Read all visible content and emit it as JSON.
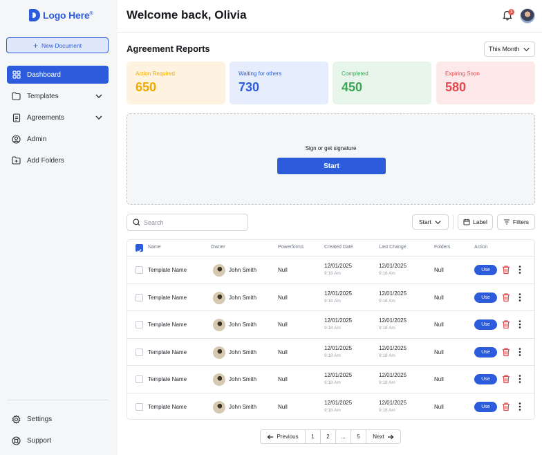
{
  "brand": {
    "logo_text": "Logo Here",
    "logo_mark": "®",
    "accent": "#2c5cdb"
  },
  "sidebar": {
    "new_document": "New Document",
    "items": [
      {
        "label": "Dashboard",
        "icon": "grid-icon",
        "active": true
      },
      {
        "label": "Templates",
        "icon": "folder-icon",
        "expandable": true
      },
      {
        "label": "Agreements",
        "icon": "document-icon",
        "expandable": true
      },
      {
        "label": "Admin",
        "icon": "user-icon"
      },
      {
        "label": "Add Folders",
        "icon": "folder-plus-icon"
      }
    ],
    "bottom_items": [
      {
        "label": "Settings",
        "icon": "gear-icon"
      },
      {
        "label": "Support",
        "icon": "lifebuoy-icon"
      }
    ]
  },
  "header": {
    "title": "Welcome back, Olivia",
    "notification_count": "3"
  },
  "reports": {
    "title": "Agreement Reports",
    "period": "This Month",
    "stats": [
      {
        "label": "Action Required",
        "value": "650",
        "color": "#f2a900",
        "bg": "#fdf3e0"
      },
      {
        "label": "Waiting for others",
        "value": "730",
        "color": "#2c5cdb",
        "bg": "#e6edfc"
      },
      {
        "label": "Completed",
        "value": "450",
        "color": "#3aa654",
        "bg": "#e8f5eb"
      },
      {
        "label": "Expiring Soon",
        "value": "580",
        "color": "#e5484d",
        "bg": "#fde9ea"
      }
    ]
  },
  "signature": {
    "prompt": "Sign or get signature",
    "button": "Start"
  },
  "toolbar": {
    "search_placeholder": "Search",
    "start_filter": "Start",
    "label_button": "Label",
    "filters_button": "Filters"
  },
  "table": {
    "columns": [
      "Name",
      "Owner",
      "Powerforms",
      "Created Date",
      "Last Change",
      "Folders",
      "Action"
    ],
    "rows": [
      {
        "name": "Template Name",
        "owner": "John Smith",
        "powerforms": "Null",
        "created_date": "12/01/2025",
        "created_time": "9:18 Am",
        "last_change_date": "12/01/2025",
        "last_change_time": "9:18 Am",
        "folders": "Null",
        "action": "Use"
      },
      {
        "name": "Template Name",
        "owner": "John Smith",
        "powerforms": "Null",
        "created_date": "12/01/2025",
        "created_time": "9:18 Am",
        "last_change_date": "12/01/2025",
        "last_change_time": "9:18 Am",
        "folders": "Null",
        "action": "Use"
      },
      {
        "name": "Template Name",
        "owner": "John Smith",
        "powerforms": "Null",
        "created_date": "12/01/2025",
        "created_time": "9:18 Am",
        "last_change_date": "12/01/2025",
        "last_change_time": "9:18 Am",
        "folders": "Null",
        "action": "Use"
      },
      {
        "name": "Template Name",
        "owner": "John Smith",
        "powerforms": "Null",
        "created_date": "12/01/2025",
        "created_time": "9:18 Am",
        "last_change_date": "12/01/2025",
        "last_change_time": "9:18 Am",
        "folders": "Null",
        "action": "Use"
      },
      {
        "name": "Template Name",
        "owner": "John Smith",
        "powerforms": "Null",
        "created_date": "12/01/2025",
        "created_time": "9:18 Am",
        "last_change_date": "12/01/2025",
        "last_change_time": "9:18 Am",
        "folders": "Null",
        "action": "Use"
      },
      {
        "name": "Template Name",
        "owner": "John Smith",
        "powerforms": "Null",
        "created_date": "12/01/2025",
        "created_time": "9:18 Am",
        "last_change_date": "12/01/2025",
        "last_change_time": "9:18 Am",
        "folders": "Null",
        "action": "Use"
      }
    ]
  },
  "pagination": {
    "previous": "Previous",
    "pages": [
      "1",
      "2",
      "...",
      "5"
    ],
    "next": "Next"
  }
}
